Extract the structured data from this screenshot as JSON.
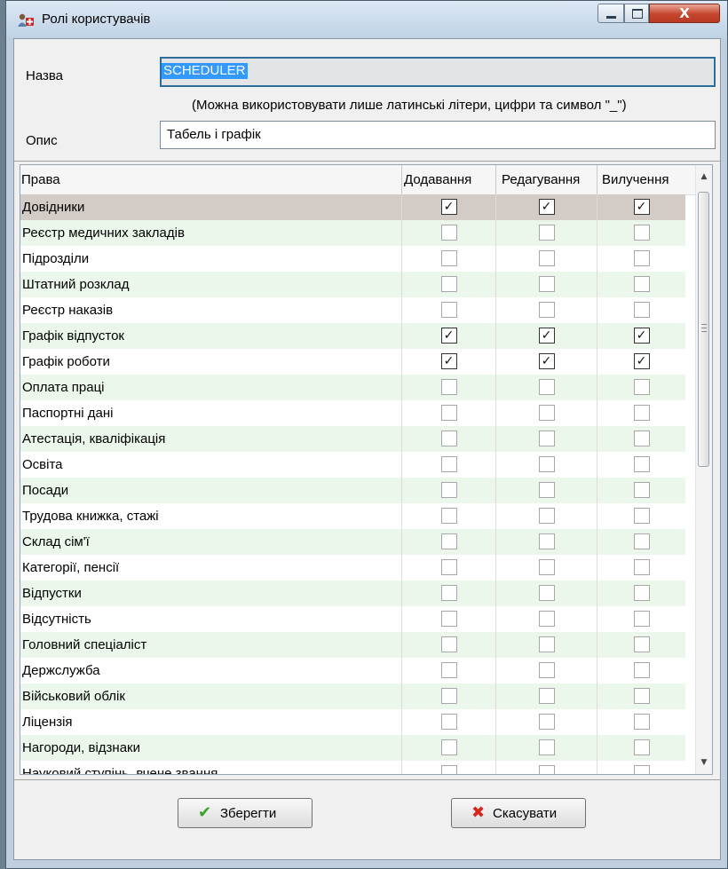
{
  "window": {
    "title": "Ролі користувачів",
    "icon": "users-role-icon",
    "controls": {
      "minimize": "minimize-icon",
      "maximize": "maximize-icon",
      "close": "X"
    }
  },
  "form": {
    "name_label": "Назва",
    "name_value": "SCHEDULER",
    "hint": "(Можна використовувати лише латинські літери, цифри та символ \"_\")",
    "desc_label": "Опис",
    "desc_value": "Табель і графік"
  },
  "grid": {
    "columns": [
      "Права",
      "Додавання",
      "Редагування",
      "Вилучення"
    ],
    "selected_row": 0,
    "rows": [
      {
        "name": "Довідники",
        "add": true,
        "edit": true,
        "del": true
      },
      {
        "name": "Реєстр медичних закладів",
        "add": false,
        "edit": false,
        "del": false
      },
      {
        "name": "Підрозділи",
        "add": false,
        "edit": false,
        "del": false
      },
      {
        "name": "Штатний розклад",
        "add": false,
        "edit": false,
        "del": false
      },
      {
        "name": "Реєстр наказів",
        "add": false,
        "edit": false,
        "del": false
      },
      {
        "name": "Графік відпусток",
        "add": true,
        "edit": true,
        "del": true
      },
      {
        "name": "Графік роботи",
        "add": true,
        "edit": true,
        "del": true
      },
      {
        "name": "Оплата праці",
        "add": false,
        "edit": false,
        "del": false
      },
      {
        "name": "Паспортні дані",
        "add": false,
        "edit": false,
        "del": false
      },
      {
        "name": "Атестація, кваліфікація",
        "add": false,
        "edit": false,
        "del": false
      },
      {
        "name": "Освіта",
        "add": false,
        "edit": false,
        "del": false
      },
      {
        "name": "Посади",
        "add": false,
        "edit": false,
        "del": false
      },
      {
        "name": "Трудова книжка, стажі",
        "add": false,
        "edit": false,
        "del": false
      },
      {
        "name": "Склад сім'ї",
        "add": false,
        "edit": false,
        "del": false
      },
      {
        "name": "Категорії, пенсії",
        "add": false,
        "edit": false,
        "del": false
      },
      {
        "name": "Відпустки",
        "add": false,
        "edit": false,
        "del": false
      },
      {
        "name": "Відсутність",
        "add": false,
        "edit": false,
        "del": false
      },
      {
        "name": "Головний спеціаліст",
        "add": false,
        "edit": false,
        "del": false
      },
      {
        "name": "Держслужба",
        "add": false,
        "edit": false,
        "del": false
      },
      {
        "name": "Військовий облік",
        "add": false,
        "edit": false,
        "del": false
      },
      {
        "name": "Ліцензія",
        "add": false,
        "edit": false,
        "del": false
      },
      {
        "name": "Нагороди, відзнаки",
        "add": false,
        "edit": false,
        "del": false
      },
      {
        "name": "Науковий ступінь, вчене звання",
        "add": false,
        "edit": false,
        "del": false
      }
    ]
  },
  "buttons": {
    "save": "Зберегти",
    "save_icon": "checkmark-icon",
    "cancel": "Скасувати",
    "cancel_icon": "cross-icon"
  },
  "colors": {
    "alt_row": "#eaf7ea",
    "selected_row": "#d2cbc6",
    "selection_highlight": "#3399ff",
    "close_button": "#c5452c"
  }
}
